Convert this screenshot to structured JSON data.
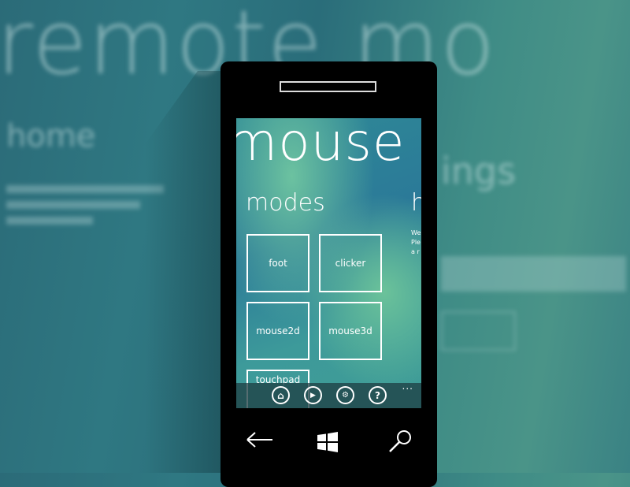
{
  "background": {
    "title": "remote mo",
    "section": "home",
    "section2": "ings"
  },
  "app": {
    "title": "mouse",
    "pivot_active": "modes",
    "pivot_next": "h",
    "peek_lines": [
      "We",
      "Ple",
      "a r"
    ]
  },
  "tiles": [
    {
      "label": "foot"
    },
    {
      "label": "clicker"
    },
    {
      "label": "mouse2d"
    },
    {
      "label": "mouse3d"
    },
    {
      "label": "touchpad"
    }
  ],
  "appbar": {
    "buttons": [
      {
        "icon": "home-icon"
      },
      {
        "icon": "play-icon"
      },
      {
        "icon": "settings-icon"
      },
      {
        "icon": "help-icon",
        "label": "?"
      }
    ],
    "more": "..."
  },
  "nav": {
    "back": "back-arrow-icon",
    "start": "windows-logo-icon",
    "search": "search-icon"
  }
}
